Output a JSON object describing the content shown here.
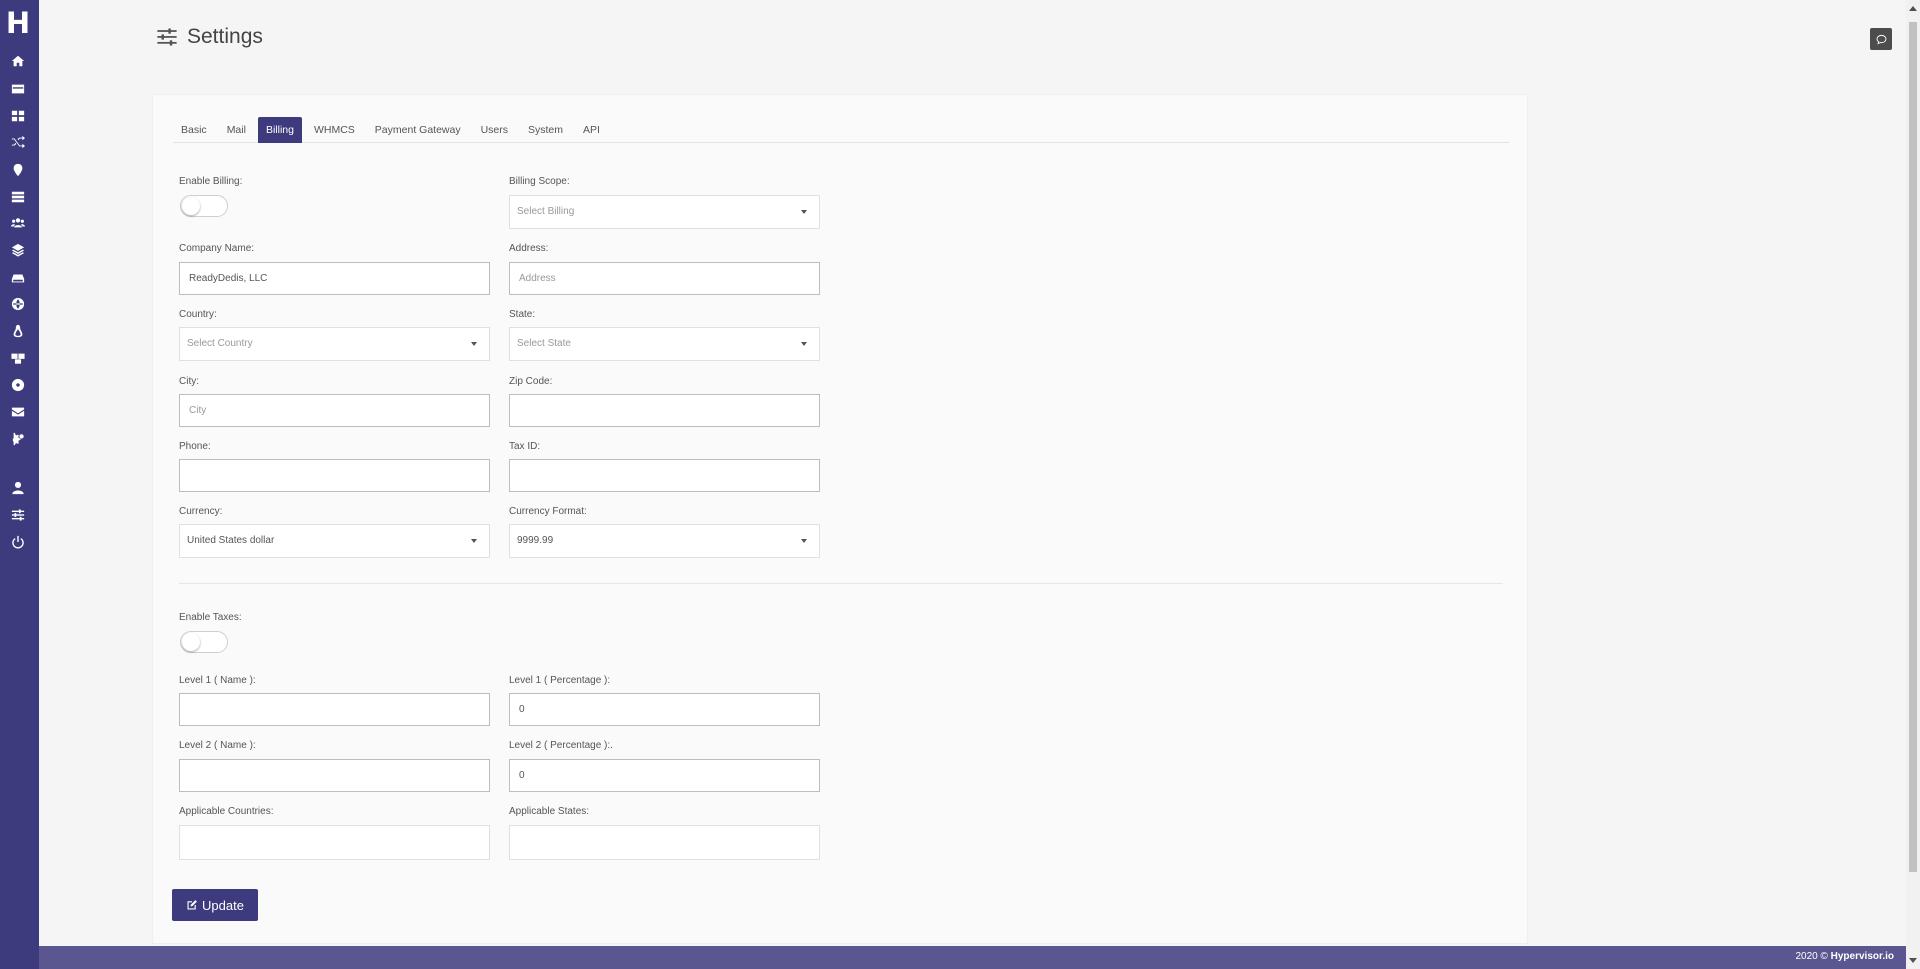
{
  "brand": {
    "logo_letter": "H"
  },
  "header": {
    "title": "Settings",
    "icon": "sliders-icon"
  },
  "sidebar": {
    "items": [
      {
        "name": "home",
        "icon": "home-icon"
      },
      {
        "name": "billing",
        "icon": "credit-card-icon"
      },
      {
        "name": "dashboard",
        "icon": "grid-icon"
      },
      {
        "name": "random",
        "icon": "shuffle-icon"
      },
      {
        "name": "locations",
        "icon": "map-marker-icon"
      },
      {
        "name": "servers",
        "icon": "server-icon"
      },
      {
        "name": "users",
        "icon": "users-icon"
      },
      {
        "name": "layers",
        "icon": "layers-icon"
      },
      {
        "name": "storage",
        "icon": "hdd-icon"
      },
      {
        "name": "network",
        "icon": "globe-icon"
      },
      {
        "name": "os",
        "icon": "linux-icon"
      },
      {
        "name": "packages",
        "icon": "boxes-icon"
      },
      {
        "name": "media",
        "icon": "disc-icon"
      },
      {
        "name": "mail",
        "icon": "envelope-icon"
      },
      {
        "name": "system",
        "icon": "cogs-icon"
      },
      {
        "name": "profile",
        "icon": "user-icon"
      },
      {
        "name": "settings",
        "icon": "sliders-icon"
      },
      {
        "name": "logout",
        "icon": "power-icon"
      }
    ]
  },
  "tabs": [
    {
      "label": "Basic",
      "active": false
    },
    {
      "label": "Mail",
      "active": false
    },
    {
      "label": "Billing",
      "active": true
    },
    {
      "label": "WHMCS",
      "active": false
    },
    {
      "label": "Payment Gateway",
      "active": false
    },
    {
      "label": "Users",
      "active": false
    },
    {
      "label": "System",
      "active": false
    },
    {
      "label": "API",
      "active": false
    }
  ],
  "form": {
    "enable_billing": {
      "label": "Enable Billing:",
      "on": false
    },
    "billing_scope": {
      "label": "Billing Scope:",
      "placeholder": "Select Billing"
    },
    "company_name": {
      "label": "Company Name:",
      "value": "ReadyDedis, LLC"
    },
    "address": {
      "label": "Address:",
      "placeholder": "Address"
    },
    "country": {
      "label": "Country:",
      "placeholder": "Select Country"
    },
    "state": {
      "label": "State:",
      "placeholder": "Select State"
    },
    "city": {
      "label": "City:",
      "placeholder": "City"
    },
    "zip": {
      "label": "Zip Code:",
      "value": ""
    },
    "phone": {
      "label": "Phone:",
      "value": ""
    },
    "tax_id": {
      "label": "Tax ID:",
      "value": ""
    },
    "currency": {
      "label": "Currency:",
      "value": "United States dollar"
    },
    "currency_format": {
      "label": "Currency Format:",
      "value": "9999.99"
    },
    "enable_taxes": {
      "label": "Enable Taxes:",
      "on": false
    },
    "level1_name": {
      "label": "Level 1 ( Name ):",
      "value": ""
    },
    "level1_pct": {
      "label": "Level 1 ( Percentage ):",
      "value": "0"
    },
    "level2_name": {
      "label": "Level 2 ( Name ):",
      "value": ""
    },
    "level2_pct": {
      "label": "Level 2 ( Percentage ):.",
      "value": "0"
    },
    "applicable_countries": {
      "label": "Applicable Countries:"
    },
    "applicable_states": {
      "label": "Applicable States:"
    }
  },
  "actions": {
    "update_label": "Update"
  },
  "footer": {
    "year": "2020 ©",
    "brand": "Hypervisor.io"
  },
  "colors": {
    "primary": "#3d3a7e",
    "footer": "#5a5790"
  }
}
